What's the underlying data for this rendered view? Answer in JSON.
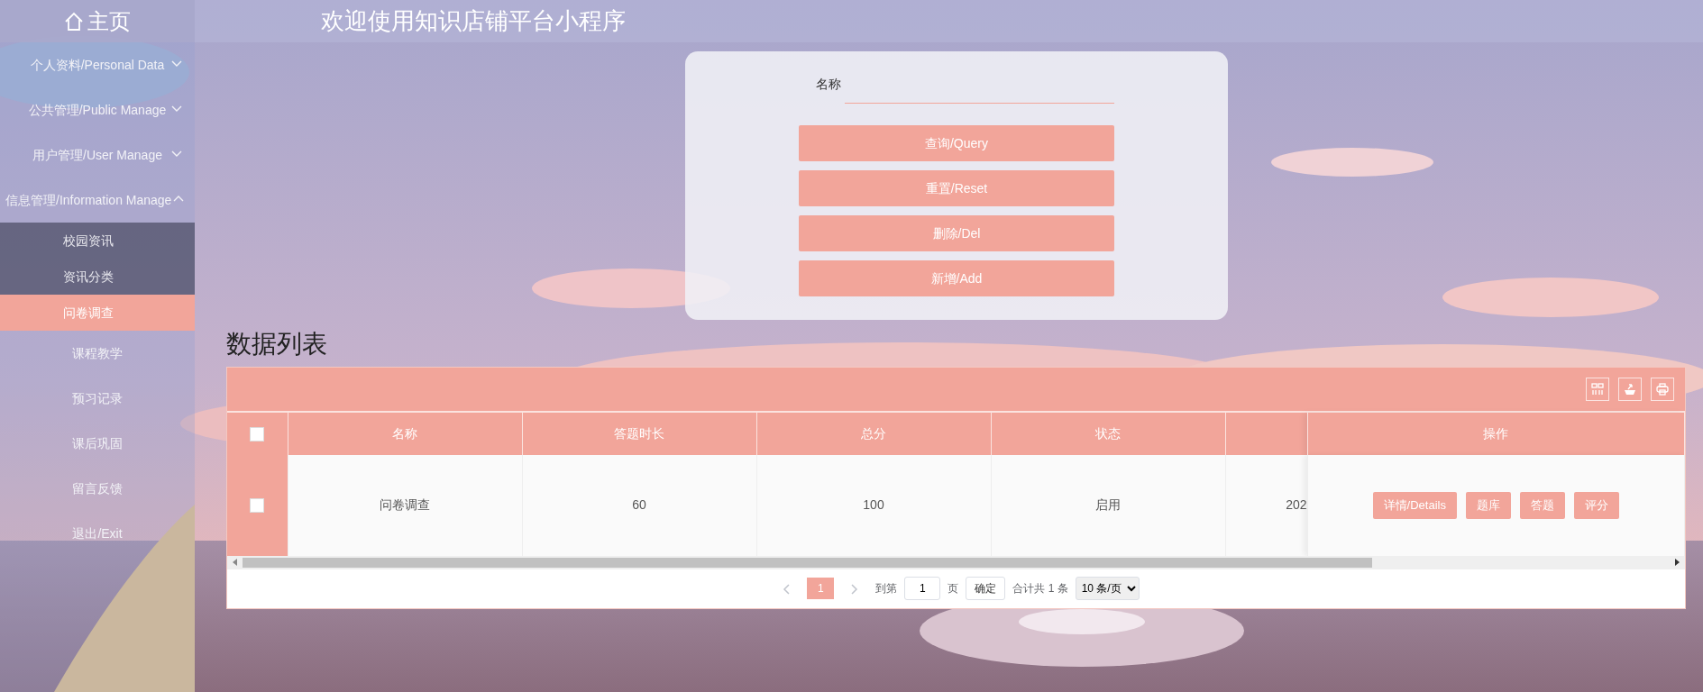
{
  "header": {
    "home_label": "主页",
    "title": "欢迎使用知识店铺平台小程序"
  },
  "sidebar": {
    "items": [
      {
        "kind": "group",
        "label": "个人资料/Personal Data",
        "expanded": false,
        "selected": false
      },
      {
        "kind": "group",
        "label": "公共管理/Public Manage",
        "expanded": false,
        "selected": false
      },
      {
        "kind": "group",
        "label": "用户管理/User Manage",
        "expanded": false,
        "selected": false
      },
      {
        "kind": "group",
        "label": "信息管理/Information Manage",
        "expanded": true,
        "selected": false,
        "children": [
          {
            "label": "校园资讯",
            "selected": false
          },
          {
            "label": "资讯分类",
            "selected": false
          },
          {
            "label": "问卷调查",
            "selected": true
          }
        ]
      },
      {
        "kind": "link",
        "label": "课程教学",
        "selected": false
      },
      {
        "kind": "link",
        "label": "预习记录",
        "selected": false
      },
      {
        "kind": "link",
        "label": "课后巩固",
        "selected": false
      },
      {
        "kind": "link",
        "label": "留言反馈",
        "selected": false
      },
      {
        "kind": "link",
        "label": "退出/Exit",
        "selected": false
      }
    ]
  },
  "search": {
    "field_label": "名称",
    "buttons": [
      "查询/Query",
      "重置/Reset",
      "删除/Del",
      "新增/Add"
    ]
  },
  "table": {
    "title": "数据列表",
    "select_all": {
      "checked": false
    },
    "columns": [
      {
        "kind": "text",
        "label": "名称"
      },
      {
        "kind": "text",
        "label": "答题时长"
      },
      {
        "kind": "text",
        "label": "总分"
      },
      {
        "kind": "text",
        "label": "状态"
      },
      {
        "kind": "cut"
      },
      {
        "kind": "actions",
        "label": "操作"
      }
    ],
    "rows": [
      {
        "selected": false,
        "cells": [
          "问卷调查",
          "60",
          "100",
          "启用",
          "202"
        ],
        "actions": [
          "详情/Details",
          "题库",
          "答题",
          "评分"
        ]
      }
    ]
  },
  "pagination": {
    "pages": [
      {
        "label": "1",
        "selected": true
      }
    ],
    "goto_label": "到第",
    "goto_value": "1",
    "page_unit": "页",
    "confirm": "确定",
    "total": "合计共 1 条",
    "page_size": "10 条/页"
  }
}
